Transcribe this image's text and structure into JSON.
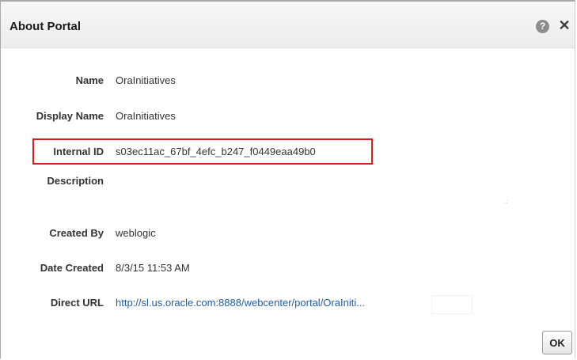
{
  "dialog": {
    "title": "About Portal",
    "help_glyph": "?",
    "close_glyph": "✕",
    "icons": [
      "help-icon",
      "close-icon",
      "resize-grip-icon"
    ]
  },
  "fields": {
    "name": {
      "label": "Name",
      "value": "OraInitiatives"
    },
    "display_name": {
      "label": "Display Name",
      "value": "OraInitiatives"
    },
    "internal_id": {
      "label": "Internal ID",
      "value": "s03ec11ac_67bf_4efc_b247_f0449eaa49b0"
    },
    "description": {
      "label": "Description",
      "value": ""
    },
    "created_by": {
      "label": "Created By",
      "value": "weblogic"
    },
    "date_created": {
      "label": "Date Created",
      "value": "8/3/15 11:53 AM"
    },
    "direct_url": {
      "label": "Direct URL",
      "value": "http://sl.us.oracle.com:8888/webcenter/portal/OraIniti..."
    }
  },
  "buttons": {
    "ok_label": "OK"
  },
  "colors": {
    "highlight": "#e01b1b",
    "link": "#1f5fa6"
  }
}
